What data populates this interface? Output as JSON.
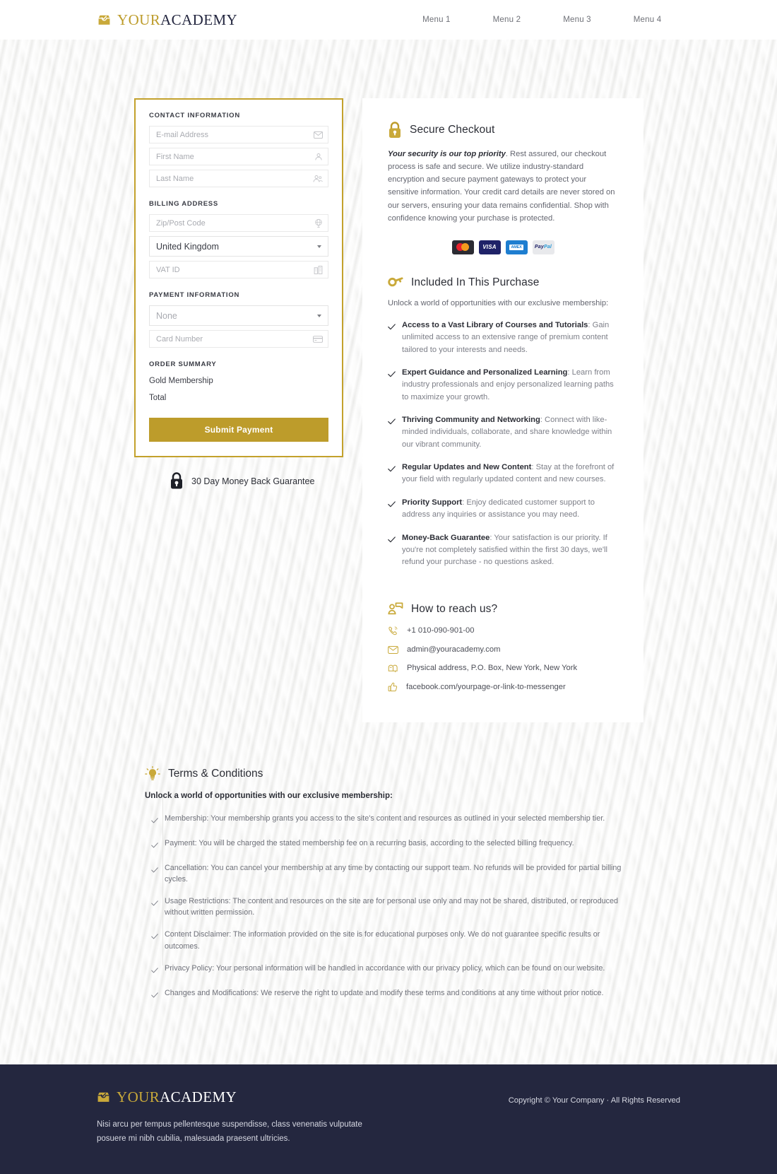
{
  "colors": {
    "gold": "#bd9c2b",
    "gold_border": "#c3a12c",
    "navy": "#24273f",
    "page_bg": "#f6f6f5"
  },
  "header": {
    "logo": {
      "part1": "YOUR",
      "part2": "ACADEMY",
      "icon": "inbox-check-icon"
    },
    "nav": [
      {
        "label": "Menu 1"
      },
      {
        "label": "Menu 2"
      },
      {
        "label": "Menu 3"
      },
      {
        "label": "Menu 4"
      }
    ]
  },
  "form": {
    "contact_label": "CONTACT INFORMATION",
    "email_placeholder": "E-mail Address",
    "email_value": "",
    "first_name_placeholder": "First Name",
    "first_name_value": "",
    "last_name_placeholder": "Last Name",
    "last_name_value": "",
    "billing_label": "BILLING ADDRESS",
    "zip_placeholder": "Zip/Post Code",
    "zip_value": "",
    "country_value": "United Kingdom",
    "vat_placeholder": "VAT ID",
    "vat_value": "",
    "payment_label": "PAYMENT INFORMATION",
    "payment_method_value": "None",
    "card_placeholder": "Card Number",
    "card_value": "",
    "order_label": "ORDER SUMMARY",
    "order_item": "Gold Membership",
    "order_total": "Total",
    "submit_label": "Submit Payment"
  },
  "guarantee": {
    "icon": "padlock-icon",
    "text": "30 Day Money Back Guarantee"
  },
  "secure": {
    "icon": "padlock-icon",
    "title": "Secure Checkout",
    "lead": "Your security is our top priority",
    "body": ". Rest assured, our checkout process is safe and secure. We utilize industry-standard encryption and secure payment gateways to protect your sensitive information. Your credit card details are never stored on our servers, ensuring your data remains confidential. Shop with confidence knowing your purchase is protected.",
    "payment_badges": [
      {
        "name": "mastercard"
      },
      {
        "name": "visa",
        "label": "VISA"
      },
      {
        "name": "amex",
        "label": "AMEX"
      },
      {
        "name": "paypal",
        "label_a": "Pay",
        "label_b": "Pal"
      }
    ]
  },
  "included": {
    "icon": "key-icon",
    "title": "Included In This Purchase",
    "intro": "Unlock a world of opportunities with our exclusive membership:",
    "items": [
      {
        "title": "Access to a Vast Library of Courses and Tutorials",
        "desc": ": Gain unlimited access to an extensive range of premium content tailored to your interests and needs."
      },
      {
        "title": "Expert Guidance and Personalized Learning",
        "desc": ": Learn from industry professionals and enjoy personalized learning paths to maximize your growth."
      },
      {
        "title": "Thriving Community and Networking",
        "desc": ": Connect with like-minded individuals, collaborate, and share knowledge within our vibrant community."
      },
      {
        "title": "Regular Updates and New Content",
        "desc": ": Stay at the forefront of your field with regularly updated content and new courses."
      },
      {
        "title": "Priority Support",
        "desc": ": Enjoy dedicated customer support to address any inquiries or assistance you may need."
      },
      {
        "title": "Money-Back Guarantee",
        "desc": ": Your satisfaction is our priority. If you're not completely satisfied within the first 30 days, we'll refund your purchase - no questions asked."
      }
    ]
  },
  "contact": {
    "icon": "person-message-icon",
    "title": "How to reach us?",
    "rows": [
      {
        "icon": "phone-icon",
        "text": "+1 010-090-901-00"
      },
      {
        "icon": "envelope-icon",
        "text": "admin@youracademy.com"
      },
      {
        "icon": "mailbox-icon",
        "text": "Physical address, P.O. Box, New York, New York"
      },
      {
        "icon": "thumbs-up-icon",
        "text": "facebook.com/yourpage-or-link-to-messenger"
      }
    ]
  },
  "terms": {
    "icon": "lightbulb-icon",
    "title": "Terms & Conditions",
    "intro": "Unlock a world of opportunities with our exclusive membership:",
    "items": [
      {
        "text": "Membership: Your membership grants you access to the site's content and resources as outlined in your selected membership tier."
      },
      {
        "text": "Payment: You will be charged the stated membership fee on a recurring basis, according to the selected billing frequency."
      },
      {
        "text": "Cancellation: You can cancel your membership at any time by contacting our support team. No refunds will be provided for partial billing cycles."
      },
      {
        "text": "Usage Restrictions: The content and resources on the site are for personal use only and may not be shared, distributed, or reproduced without written permission."
      },
      {
        "text": "Content Disclaimer: The information provided on the site is for educational purposes only. We do not guarantee specific results or outcomes."
      },
      {
        "text": "Privacy Policy: Your personal information will be handled in accordance with our privacy policy, which can be found on our website."
      },
      {
        "text": "Changes and Modifications: We reserve the right to update and modify these terms and conditions at any time without prior notice."
      }
    ]
  },
  "footer": {
    "logo": {
      "part1": "YOUR",
      "part2": "ACADEMY",
      "icon": "inbox-check-icon"
    },
    "tagline": "Nisi arcu per tempus pellentesque suspendisse, class venenatis vulputate posuere mi nibh cubilia, malesuada praesent ultricies.",
    "copyright": "Copyright © Your Company · All Rights Reserved"
  }
}
